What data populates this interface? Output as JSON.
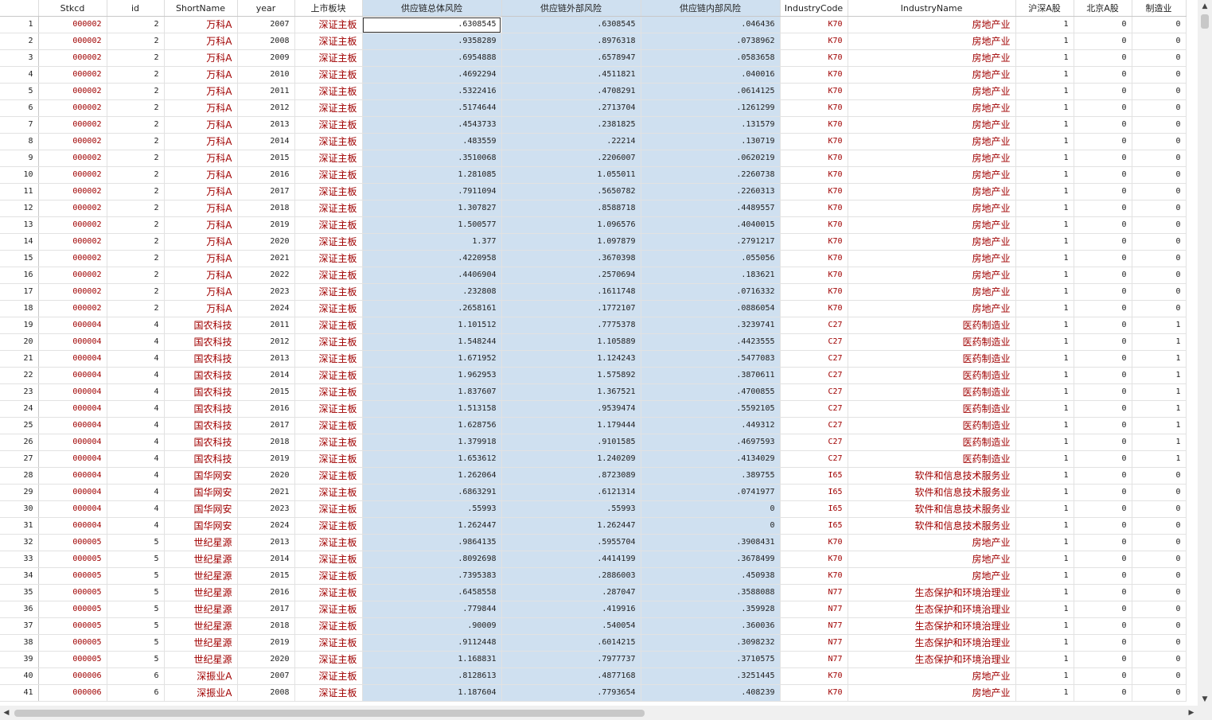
{
  "columns": [
    "Stkcd",
    "id",
    "ShortName",
    "year",
    "上市板块",
    "供应链总体风险",
    "供应链外部风险",
    "供应链内部风险",
    "IndustryCode",
    "IndustryName",
    "沪深A股",
    "北京A股",
    "制造业"
  ],
  "colors": {
    "string_text": "#a00000",
    "selection": "#cfe0f0"
  },
  "rows": [
    [
      "000002",
      "2",
      "万科A",
      "2007",
      "深证主板",
      ".6308545",
      ".6308545",
      ".046436",
      "K70",
      "房地产业",
      "1",
      "0",
      "0"
    ],
    [
      "000002",
      "2",
      "万科A",
      "2008",
      "深证主板",
      ".9358289",
      ".8976318",
      ".0738962",
      "K70",
      "房地产业",
      "1",
      "0",
      "0"
    ],
    [
      "000002",
      "2",
      "万科A",
      "2009",
      "深证主板",
      ".6954888",
      ".6578947",
      ".0583658",
      "K70",
      "房地产业",
      "1",
      "0",
      "0"
    ],
    [
      "000002",
      "2",
      "万科A",
      "2010",
      "深证主板",
      ".4692294",
      ".4511821",
      ".040016",
      "K70",
      "房地产业",
      "1",
      "0",
      "0"
    ],
    [
      "000002",
      "2",
      "万科A",
      "2011",
      "深证主板",
      ".5322416",
      ".4708291",
      ".0614125",
      "K70",
      "房地产业",
      "1",
      "0",
      "0"
    ],
    [
      "000002",
      "2",
      "万科A",
      "2012",
      "深证主板",
      ".5174644",
      ".2713704",
      ".1261299",
      "K70",
      "房地产业",
      "1",
      "0",
      "0"
    ],
    [
      "000002",
      "2",
      "万科A",
      "2013",
      "深证主板",
      ".4543733",
      ".2381825",
      ".131579",
      "K70",
      "房地产业",
      "1",
      "0",
      "0"
    ],
    [
      "000002",
      "2",
      "万科A",
      "2014",
      "深证主板",
      ".483559",
      ".22214",
      ".130719",
      "K70",
      "房地产业",
      "1",
      "0",
      "0"
    ],
    [
      "000002",
      "2",
      "万科A",
      "2015",
      "深证主板",
      ".3510068",
      ".2206007",
      ".0620219",
      "K70",
      "房地产业",
      "1",
      "0",
      "0"
    ],
    [
      "000002",
      "2",
      "万科A",
      "2016",
      "深证主板",
      "1.281085",
      "1.055011",
      ".2260738",
      "K70",
      "房地产业",
      "1",
      "0",
      "0"
    ],
    [
      "000002",
      "2",
      "万科A",
      "2017",
      "深证主板",
      ".7911094",
      ".5650782",
      ".2260313",
      "K70",
      "房地产业",
      "1",
      "0",
      "0"
    ],
    [
      "000002",
      "2",
      "万科A",
      "2018",
      "深证主板",
      "1.307827",
      ".8588718",
      ".4489557",
      "K70",
      "房地产业",
      "1",
      "0",
      "0"
    ],
    [
      "000002",
      "2",
      "万科A",
      "2019",
      "深证主板",
      "1.500577",
      "1.096576",
      ".4040015",
      "K70",
      "房地产业",
      "1",
      "0",
      "0"
    ],
    [
      "000002",
      "2",
      "万科A",
      "2020",
      "深证主板",
      "1.377",
      "1.097879",
      ".2791217",
      "K70",
      "房地产业",
      "1",
      "0",
      "0"
    ],
    [
      "000002",
      "2",
      "万科A",
      "2021",
      "深证主板",
      ".4220958",
      ".3670398",
      ".055056",
      "K70",
      "房地产业",
      "1",
      "0",
      "0"
    ],
    [
      "000002",
      "2",
      "万科A",
      "2022",
      "深证主板",
      ".4406904",
      ".2570694",
      ".183621",
      "K70",
      "房地产业",
      "1",
      "0",
      "0"
    ],
    [
      "000002",
      "2",
      "万科A",
      "2023",
      "深证主板",
      ".232808",
      ".1611748",
      ".0716332",
      "K70",
      "房地产业",
      "1",
      "0",
      "0"
    ],
    [
      "000002",
      "2",
      "万科A",
      "2024",
      "深证主板",
      ".2658161",
      ".1772107",
      ".0886054",
      "K70",
      "房地产业",
      "1",
      "0",
      "0"
    ],
    [
      "000004",
      "4",
      "国农科技",
      "2011",
      "深证主板",
      "1.101512",
      ".7775378",
      ".3239741",
      "C27",
      "医药制造业",
      "1",
      "0",
      "1"
    ],
    [
      "000004",
      "4",
      "国农科技",
      "2012",
      "深证主板",
      "1.548244",
      "1.105889",
      ".4423555",
      "C27",
      "医药制造业",
      "1",
      "0",
      "1"
    ],
    [
      "000004",
      "4",
      "国农科技",
      "2013",
      "深证主板",
      "1.671952",
      "1.124243",
      ".5477083",
      "C27",
      "医药制造业",
      "1",
      "0",
      "1"
    ],
    [
      "000004",
      "4",
      "国农科技",
      "2014",
      "深证主板",
      "1.962953",
      "1.575892",
      ".3870611",
      "C27",
      "医药制造业",
      "1",
      "0",
      "1"
    ],
    [
      "000004",
      "4",
      "国农科技",
      "2015",
      "深证主板",
      "1.837607",
      "1.367521",
      ".4700855",
      "C27",
      "医药制造业",
      "1",
      "0",
      "1"
    ],
    [
      "000004",
      "4",
      "国农科技",
      "2016",
      "深证主板",
      "1.513158",
      ".9539474",
      ".5592105",
      "C27",
      "医药制造业",
      "1",
      "0",
      "1"
    ],
    [
      "000004",
      "4",
      "国农科技",
      "2017",
      "深证主板",
      "1.628756",
      "1.179444",
      ".449312",
      "C27",
      "医药制造业",
      "1",
      "0",
      "1"
    ],
    [
      "000004",
      "4",
      "国农科技",
      "2018",
      "深证主板",
      "1.379918",
      ".9101585",
      ".4697593",
      "C27",
      "医药制造业",
      "1",
      "0",
      "1"
    ],
    [
      "000004",
      "4",
      "国农科技",
      "2019",
      "深证主板",
      "1.653612",
      "1.240209",
      ".4134029",
      "C27",
      "医药制造业",
      "1",
      "0",
      "1"
    ],
    [
      "000004",
      "4",
      "国华网安",
      "2020",
      "深证主板",
      "1.262064",
      ".8723089",
      ".389755",
      "I65",
      "软件和信息技术服务业",
      "1",
      "0",
      "0"
    ],
    [
      "000004",
      "4",
      "国华网安",
      "2021",
      "深证主板",
      ".6863291",
      ".6121314",
      ".0741977",
      "I65",
      "软件和信息技术服务业",
      "1",
      "0",
      "0"
    ],
    [
      "000004",
      "4",
      "国华网安",
      "2023",
      "深证主板",
      ".55993",
      ".55993",
      "0",
      "I65",
      "软件和信息技术服务业",
      "1",
      "0",
      "0"
    ],
    [
      "000004",
      "4",
      "国华网安",
      "2024",
      "深证主板",
      "1.262447",
      "1.262447",
      "0",
      "I65",
      "软件和信息技术服务业",
      "1",
      "0",
      "0"
    ],
    [
      "000005",
      "5",
      "世纪星源",
      "2013",
      "深证主板",
      ".9864135",
      ".5955704",
      ".3908431",
      "K70",
      "房地产业",
      "1",
      "0",
      "0"
    ],
    [
      "000005",
      "5",
      "世纪星源",
      "2014",
      "深证主板",
      ".8092698",
      ".4414199",
      ".3678499",
      "K70",
      "房地产业",
      "1",
      "0",
      "0"
    ],
    [
      "000005",
      "5",
      "世纪星源",
      "2015",
      "深证主板",
      ".7395383",
      ".2886003",
      ".450938",
      "K70",
      "房地产业",
      "1",
      "0",
      "0"
    ],
    [
      "000005",
      "5",
      "世纪星源",
      "2016",
      "深证主板",
      ".6458558",
      ".287047",
      ".3588088",
      "N77",
      "生态保护和环境治理业",
      "1",
      "0",
      "0"
    ],
    [
      "000005",
      "5",
      "世纪星源",
      "2017",
      "深证主板",
      ".779844",
      ".419916",
      ".359928",
      "N77",
      "生态保护和环境治理业",
      "1",
      "0",
      "0"
    ],
    [
      "000005",
      "5",
      "世纪星源",
      "2018",
      "深证主板",
      ".90009",
      ".540054",
      ".360036",
      "N77",
      "生态保护和环境治理业",
      "1",
      "0",
      "0"
    ],
    [
      "000005",
      "5",
      "世纪星源",
      "2019",
      "深证主板",
      ".9112448",
      ".6014215",
      ".3098232",
      "N77",
      "生态保护和环境治理业",
      "1",
      "0",
      "0"
    ],
    [
      "000005",
      "5",
      "世纪星源",
      "2020",
      "深证主板",
      "1.168831",
      ".7977737",
      ".3710575",
      "N77",
      "生态保护和环境治理业",
      "1",
      "0",
      "0"
    ],
    [
      "000006",
      "6",
      "深振业A",
      "2007",
      "深证主板",
      ".8128613",
      ".4877168",
      ".3251445",
      "K70",
      "房地产业",
      "1",
      "0",
      "0"
    ],
    [
      "000006",
      "6",
      "深振业A",
      "2008",
      "深证主板",
      "1.187604",
      ".7793654",
      ".408239",
      "K70",
      "房地产业",
      "1",
      "0",
      "0"
    ]
  ]
}
